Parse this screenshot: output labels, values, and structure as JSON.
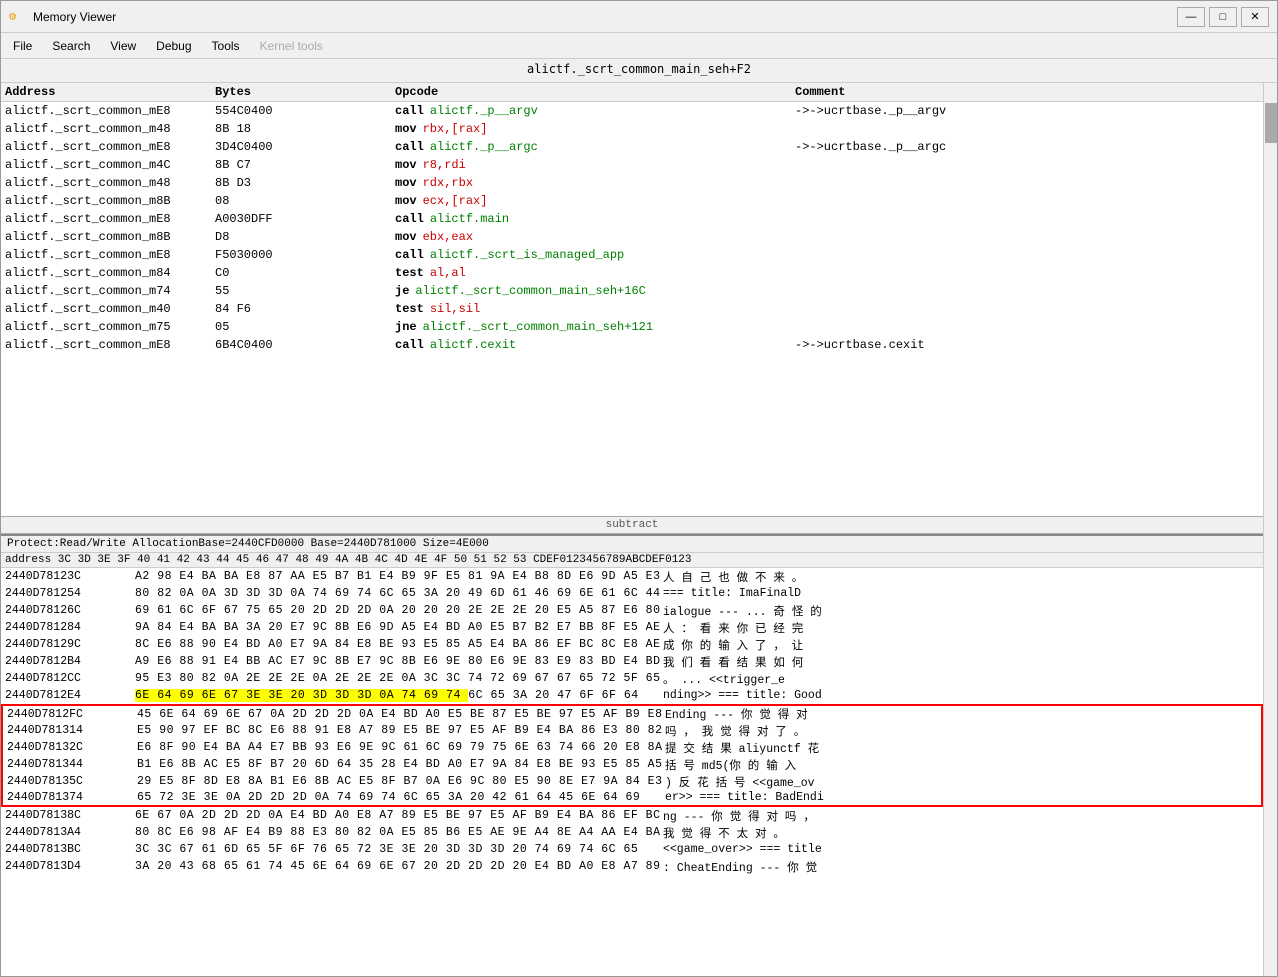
{
  "window": {
    "title": "Memory Viewer",
    "icon": "⚙",
    "controls": [
      "—",
      "□",
      "✕"
    ]
  },
  "menu": {
    "items": [
      "File",
      "Search",
      "View",
      "Debug",
      "Tools",
      "Kernel tools"
    ]
  },
  "location_bar": "alictf._scrt_common_main_seh+F2",
  "disasm": {
    "headers": [
      "Address",
      "Bytes",
      "Opcode",
      "Comment"
    ],
    "divider_label": "subtract",
    "rows": [
      {
        "addr": "alictf._scrt_common_mE8",
        "bytes": "554C0400",
        "op": "call",
        "operand": "alictf._p__argv",
        "comment": "->->ucrtbase._p__argv",
        "op_color": "green"
      },
      {
        "addr": "alictf._scrt_common_m48",
        "bytes": "8B 18",
        "op": "mov",
        "operand": "rbx,[rax]",
        "comment": "",
        "op_color": "red"
      },
      {
        "addr": "alictf._scrt_common_mE8",
        "bytes": "3D4C0400",
        "op": "call",
        "operand": "alictf._p__argc",
        "comment": "->->ucrtbase._p__argc",
        "op_color": "green"
      },
      {
        "addr": "alictf._scrt_common_m4C",
        "bytes": "8B C7",
        "op": "mov",
        "operand": "r8,rdi",
        "comment": "",
        "op_color": "red"
      },
      {
        "addr": "alictf._scrt_common_m48",
        "bytes": "8B D3",
        "op": "mov",
        "operand": "rdx,rbx",
        "comment": "",
        "op_color": "red"
      },
      {
        "addr": "alictf._scrt_common_m8B",
        "bytes": "08",
        "op": "mov",
        "operand": "ecx,[rax]",
        "comment": "",
        "op_color": "red"
      },
      {
        "addr": "alictf._scrt_common_mE8",
        "bytes": "A0030DFF",
        "op": "call",
        "operand": "alictf.main",
        "comment": "",
        "op_color": "green"
      },
      {
        "addr": "alictf._scrt_common_m8B",
        "bytes": "D8",
        "op": "mov",
        "operand": "ebx,eax",
        "comment": "",
        "op_color": "red"
      },
      {
        "addr": "alictf._scrt_common_mE8",
        "bytes": "F5030000",
        "op": "call",
        "operand": "alictf._scrt_is_managed_app",
        "comment": "",
        "op_color": "green"
      },
      {
        "addr": "alictf._scrt_common_m84",
        "bytes": "C0",
        "op": "test",
        "operand": "al,al",
        "comment": "",
        "op_color": "red"
      },
      {
        "addr": "alictf._scrt_common_m74",
        "bytes": "55",
        "op": "je",
        "operand": "alictf._scrt_common_main_seh+16C",
        "comment": "",
        "op_color": "green"
      },
      {
        "addr": "alictf._scrt_common_m40",
        "bytes": "84 F6",
        "op": "test",
        "operand": "sil,sil",
        "comment": "",
        "op_color": "red"
      },
      {
        "addr": "alictf._scrt_common_m75",
        "bytes": "05",
        "op": "jne",
        "operand": "alictf._scrt_common_main_seh+121",
        "comment": "",
        "op_color": "green"
      },
      {
        "addr": "alictf._scrt_common_mE8",
        "bytes": "6B4C0400",
        "op": "call",
        "operand": "alictf.cexit",
        "comment": "->->ucrtbase.cexit",
        "op_color": "green"
      }
    ]
  },
  "hex": {
    "info_bar": "Protect:Read/Write  AllocationBase=2440CFD0000  Base=2440D781000  Size=4E000",
    "header": "address    3C 3D 3E 3F 40 41 42 43 44 45 46 47 48 49 4A 4B 4C 4D 4E 4F  50 51 52 53  CDEF0123456789ABCDEF0123",
    "rows": [
      {
        "addr": "2440D78123C",
        "bytes": "A2 98 E4 BA BA E8 87 AA E5 B7 B1 E4 B9 9F E5 81 9A E4 B8 8D E6 9D A5 E3",
        "text": "人 自 己 也 做 不 来 。",
        "highlight": false
      },
      {
        "addr": "2440D781254",
        "bytes": "80 82 0A 0A 3D 3D 3D 0A 74 69 74 6C 65 3A 20 49 6D 61 46 69 6E 61 6C 44",
        "text": "=== title: ImaFinalD",
        "highlight": false
      },
      {
        "addr": "2440D78126C",
        "bytes": "69 61 6C 6F 67 75 65 20 2D 2D 2D 0A 20 20 20 2E 2E 2E 20 E5 A5 87 E6 80",
        "text": "ialogue --- ... 奇 怪 的",
        "highlight": false
      },
      {
        "addr": "2440D781284",
        "bytes": "9A 84 E4 BA BA 3A 20 E7 9C 8B E6 9D A5 E4 BD A0 E5 B7 B2 E7 BB 8F E5 AE",
        "text": "人 ： 看 来 你 已 经 完",
        "highlight": false
      },
      {
        "addr": "2440D78129C",
        "bytes": "8C E6 88 90 E4 BD A0 E7 9A 84 E8 BE 93 E5 85 A5 E4 BA 86 EF BC 8C E8 AE",
        "text": "成 你 的 输 入 了 ， 让",
        "highlight": false
      },
      {
        "addr": "2440D7812B4",
        "bytes": "A9 E6 88 91 E4 BB AC E7 9C 8B E7 9C 8B E6 9E 80 E6 9E 83 E9 83 BD E4 BD",
        "text": "我 们 看 看 结 果 如 何",
        "highlight": false
      },
      {
        "addr": "2440D7812CC",
        "bytes": "95 E3 80 82 0A 2E 2E 2E 0A 2E 2E 2E 0A 3C 3C 74 72 69 67 67 65 72 5F 65",
        "text": "。 ... <<trigger_e",
        "highlight": false
      },
      {
        "addr": "2440D7812E4",
        "bytes": "6E 64 69 6E 67 3E 3E 20 3D 3D 3D 0A 74 69 74 6C 65 3A 20 47 6F 6F 64",
        "text": "nding>> === title: Good",
        "highlight": false,
        "yellow_range": [
          0,
          14
        ]
      },
      {
        "addr": "2440D7812FC",
        "bytes": "45 6E 64 69 6E 67 0A 2D 2D 2D 0A E4 BD A0 E5 BE 87 E5 BE 97 E5 AF B9 E8",
        "text": "Ending ---  你 觉 得 对",
        "highlight": true,
        "red_box_start": true
      },
      {
        "addr": "2440D781314",
        "bytes": "E5 90 97 EF BC 8C E6 88 91 E8 A7 89 E5 BE 97 E5 AF B9 E4 BA 86 E3 80 82",
        "text": "吗 ， 我 觉 得 对 了 。",
        "highlight": true
      },
      {
        "addr": "2440D78132C",
        "bytes": "E6 8F 90 E4 BA A4 E7 BB 93 E6 9E 9C 61 6C 69 79 75 6E 63 74 66 20 E8 8A",
        "text": "提 交 结 果 aliyunctf 花",
        "highlight": true
      },
      {
        "addr": "2440D781344",
        "bytes": "B1 E6 8B AC E5 8F B7 20 6D 64 35 28 E4 BD A0 E7 9A 84 E8 BE 93 E5 85 A5",
        "text": "括 号  md5(你 的 输 入",
        "highlight": true
      },
      {
        "addr": "2440D78135C",
        "bytes": "29 E5 8F 8D E8 8A B1 E6 8B AC E5 8F B7 0A E6 9C 80 E5 90 8E E7 9A 84 E3",
        "text": ") 反 花 括 号 <<game_ov",
        "highlight": true
      },
      {
        "addr": "2440D781374",
        "bytes": "65 72 3E 3E 0A 2D 2D 2D 0A 74 69 74 6C 65 3A 20 42 61 64 45 6E 64 69",
        "text": "er>> === title: BadEndi",
        "highlight": true,
        "red_box_end": true
      },
      {
        "addr": "2440D78138C",
        "bytes": "6E 67 0A 2D 2D 2D 0A E4 BD A0 E8 A7 89 E5 BE 97 E5 AF B9 E4 BA 86 EF BC",
        "text": "ng ---  你 觉 得 对 吗 ，",
        "highlight": false
      },
      {
        "addr": "2440D7813A4",
        "bytes": "80 8C E6 98 AF E4 B9 88 E3 80 82 0A E5 85 B6 E5 AE 9E A4 8E A4 AA E4 BA",
        "text": "我 觉 得 不 太 对 。",
        "highlight": false
      },
      {
        "addr": "2440D7813BC",
        "bytes": "3C 3C 67 61 6D 65 5F 6F 76 65 72 3E 3E 20 3D 3D 3D 20 74 69 74 6C 65",
        "text": "<<game_over>> === title",
        "highlight": false
      },
      {
        "addr": "2440D7813D4",
        "bytes": "3A 20 43 68 65 61 74 45 6E 64 69 6E 67 20 2D 2D 2D 20 E4 BD A0 E8 A7 89",
        "text": ": CheatEnding --- 你 觉",
        "highlight": false
      }
    ]
  }
}
